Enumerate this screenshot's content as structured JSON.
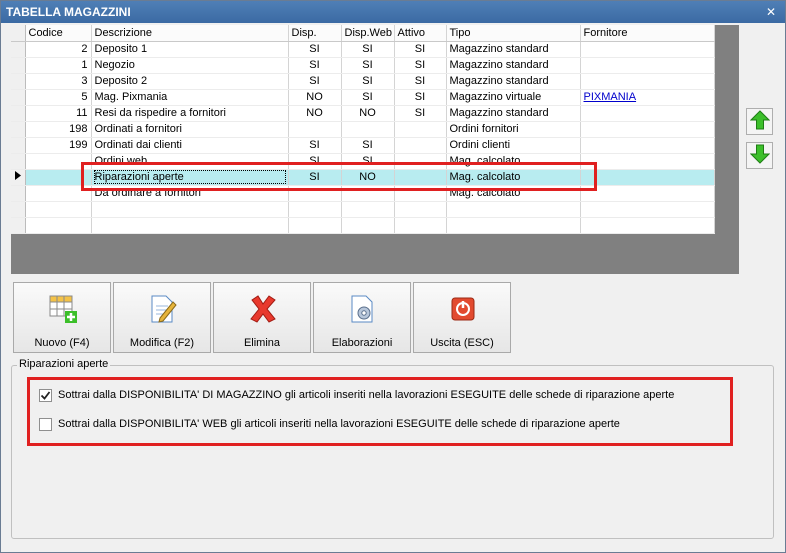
{
  "window": {
    "title": "TABELLA MAGAZZINI",
    "close_icon": "close-icon"
  },
  "grid": {
    "columns": [
      "Codice",
      "Descrizione",
      "Disp.",
      "Disp.Web",
      "Attivo",
      "Tipo",
      "Fornitore"
    ],
    "rows": [
      {
        "codice": "2",
        "descrizione": "Deposito 1",
        "disp": "SI",
        "disp_web": "SI",
        "attivo": "SI",
        "tipo": "Magazzino standard",
        "fornitore": ""
      },
      {
        "codice": "1",
        "descrizione": "Negozio",
        "disp": "SI",
        "disp_web": "SI",
        "attivo": "SI",
        "tipo": "Magazzino standard",
        "fornitore": ""
      },
      {
        "codice": "3",
        "descrizione": "Deposito 2",
        "disp": "SI",
        "disp_web": "SI",
        "attivo": "SI",
        "tipo": "Magazzino standard",
        "fornitore": ""
      },
      {
        "codice": "5",
        "descrizione": "Mag. Pixmania",
        "disp": "NO",
        "disp_web": "SI",
        "attivo": "SI",
        "tipo": "Magazzino virtuale",
        "fornitore": "PIXMANIA"
      },
      {
        "codice": "11",
        "descrizione": "Resi da rispedire a fornitori",
        "disp": "NO",
        "disp_web": "NO",
        "attivo": "SI",
        "tipo": "Magazzino standard",
        "fornitore": ""
      },
      {
        "codice": "198",
        "descrizione": "Ordinati a fornitori",
        "disp": "",
        "disp_web": "",
        "attivo": "",
        "tipo": "Ordini fornitori",
        "fornitore": ""
      },
      {
        "codice": "199",
        "descrizione": "Ordinati dai clienti",
        "disp": "SI",
        "disp_web": "SI",
        "attivo": "",
        "tipo": "Ordini clienti",
        "fornitore": ""
      },
      {
        "codice": "",
        "descrizione": "Ordini web",
        "disp": "SI",
        "disp_web": "SI",
        "attivo": "",
        "tipo": "Mag. calcolato",
        "fornitore": ""
      },
      {
        "codice": "",
        "descrizione": "Riparazioni aperte",
        "disp": "SI",
        "disp_web": "NO",
        "attivo": "",
        "tipo": "Mag. calcolato",
        "fornitore": ""
      },
      {
        "codice": "",
        "descrizione": "Da ordinare a fornitori",
        "disp": "",
        "disp_web": "",
        "attivo": "",
        "tipo": "Mag. calcolato",
        "fornitore": ""
      },
      {
        "codice": "",
        "descrizione": "",
        "disp": "",
        "disp_web": "",
        "attivo": "",
        "tipo": "",
        "fornitore": ""
      },
      {
        "codice": "",
        "descrizione": "",
        "disp": "",
        "disp_web": "",
        "attivo": "",
        "tipo": "",
        "fornitore": ""
      }
    ],
    "selected_row_index": 8
  },
  "side_buttons": {
    "up_icon": "arrow-up-icon",
    "down_icon": "arrow-down-icon"
  },
  "toolbar": {
    "new_label": "Nuovo (F4)",
    "edit_label": "Modifica (F2)",
    "delete_label": "Elimina",
    "process_label": "Elaborazioni",
    "exit_label": "Uscita (ESC)"
  },
  "options": {
    "group_title": "Riparazioni aperte",
    "opt1_label": "Sottrai dalla DISPONIBILITA' DI MAGAZZINO gli articoli inseriti nella lavorazioni ESEGUITE delle schede di riparazione aperte",
    "opt1_checked": true,
    "opt2_label": "Sottrai dalla DISPONIBILITA' WEB gli articoli inseriti nella lavorazioni ESEGUITE delle schede di riparazione aperte",
    "opt2_checked": false
  },
  "colors": {
    "highlight": "#e02020",
    "selected_row": "#b8ecf0",
    "titlebar": "#4a79b2"
  }
}
